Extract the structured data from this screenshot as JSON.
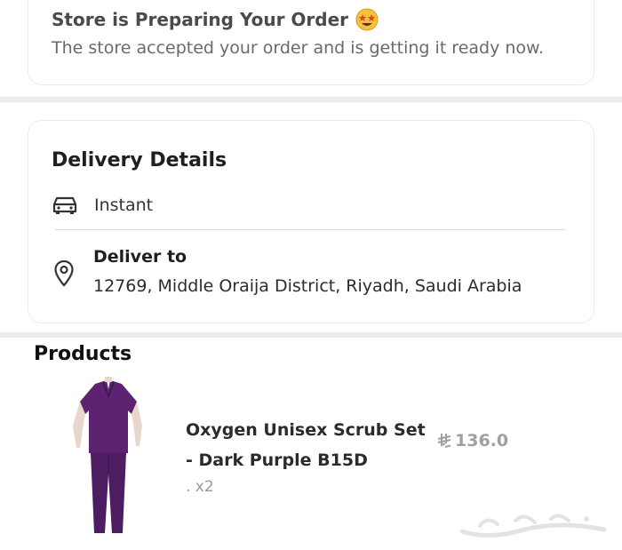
{
  "status": {
    "title": "Store is Preparing Your Order",
    "emoji": "star-struck-emoji",
    "description": "The store accepted your order and is getting it ready now."
  },
  "delivery": {
    "title": "Delivery Details",
    "method_icon": "car-icon",
    "method": "Instant",
    "deliver_label": "Deliver to",
    "location_icon": "location-pin-icon",
    "address": "12769, Middle Oraija District, Riyadh, Saudi Arabia"
  },
  "products": {
    "title": "Products",
    "items": [
      {
        "name": "Oxygen Unisex Scrub Set - Dark Purple B15D",
        "quantity": ". x2",
        "price": "136.0",
        "currency_icon": "saudi-riyal-icon",
        "image_icon": "purple-scrub-set-image"
      }
    ]
  },
  "watermark_text": "حراج"
}
